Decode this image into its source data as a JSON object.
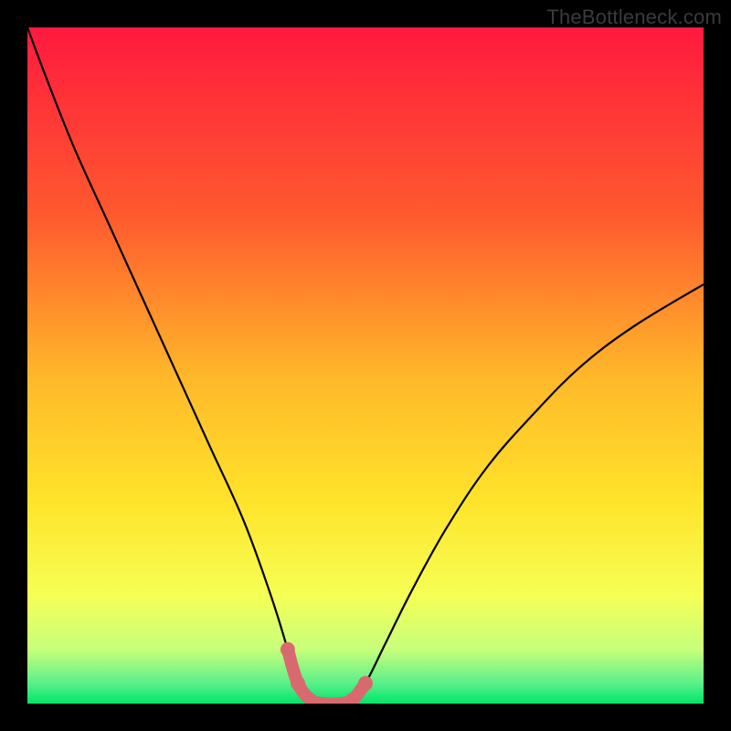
{
  "watermark": "TheBottleneck.com",
  "chart_data": {
    "type": "line",
    "title": "",
    "xlabel": "",
    "ylabel": "",
    "xlim": [
      0,
      100
    ],
    "ylim": [
      0,
      100
    ],
    "grid": false,
    "colors": {
      "gradient_top": "#ff1a3e",
      "gradient_mid_upper": "#ff7a2a",
      "gradient_mid": "#ffe32a",
      "gradient_lower": "#f5ff66",
      "gradient_bottom": "#00e56a",
      "curve": "#000000",
      "highlight": "#d86a6f",
      "background": "#000000"
    },
    "series": [
      {
        "name": "bottleneck-curve",
        "x": [
          0,
          3,
          7,
          12,
          17,
          22,
          27,
          32,
          36,
          38.5,
          40,
          42,
          44,
          46,
          48,
          50,
          53,
          57,
          62,
          68,
          75,
          82,
          90,
          100
        ],
        "y": [
          100,
          92,
          82,
          71,
          60,
          49,
          38,
          27,
          16,
          8,
          3,
          0.5,
          0,
          0,
          0.5,
          3,
          9,
          17,
          26,
          35,
          43,
          50,
          56,
          62
        ]
      },
      {
        "name": "highlight-region",
        "x": [
          38.5,
          40,
          42,
          44,
          46,
          48,
          50
        ],
        "y": [
          8,
          3,
          0.5,
          0,
          0,
          0.5,
          3
        ]
      }
    ],
    "annotations": []
  }
}
